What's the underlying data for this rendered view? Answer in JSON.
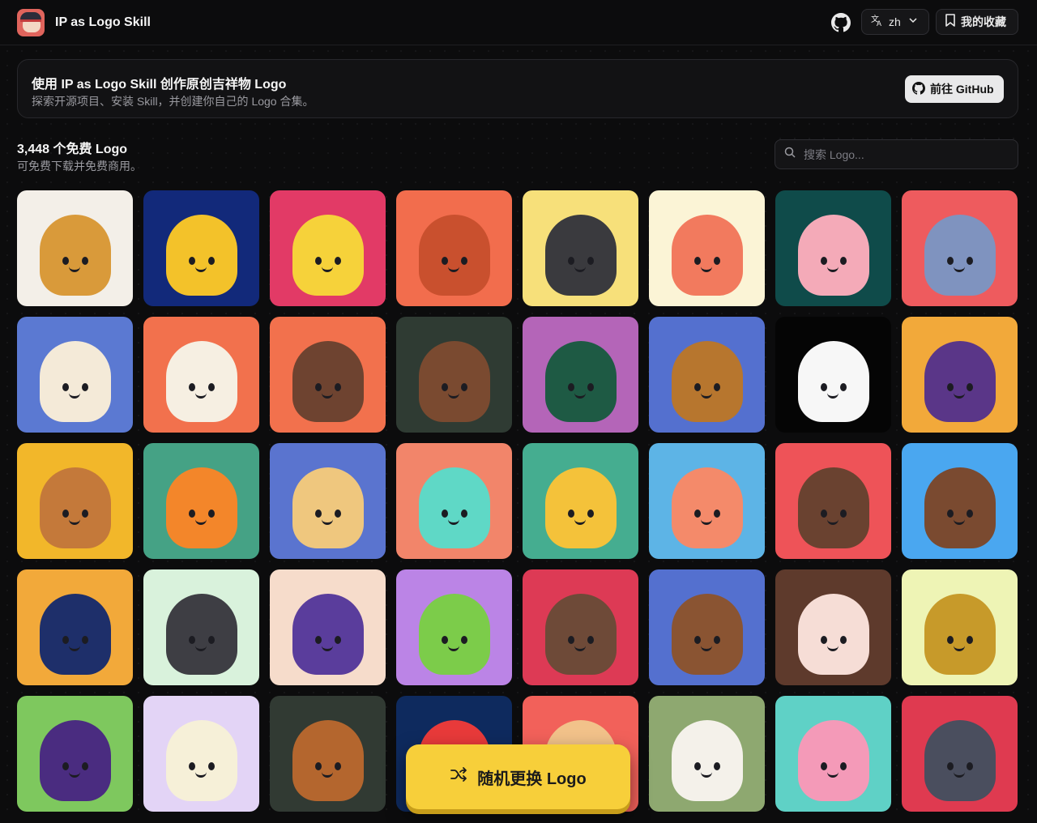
{
  "header": {
    "app_title": "IP as Logo Skill",
    "language_label": "zh",
    "favorites_label": "我的收藏"
  },
  "banner": {
    "title": "使用 IP as Logo Skill 创作原创吉祥物 Logo",
    "subtitle": "探索开源项目、安装 Skill，并创建你自己的 Logo 合集。",
    "github_button": "前往 GitHub"
  },
  "gallery": {
    "count_title": "3,448 个免费 Logo",
    "count_subtitle": "可免费下载并免费商用。",
    "search_placeholder": "搜索 Logo...",
    "tiles": [
      {
        "bg": "#f3efe8",
        "char": "#d99a3a"
      },
      {
        "bg": "#12297a",
        "char": "#f3c22a"
      },
      {
        "bg": "#e23a66",
        "char": "#f6d23a"
      },
      {
        "bg": "#f26d4d",
        "char": "#c9502e"
      },
      {
        "bg": "#f7e07a",
        "char": "#3a3a3e"
      },
      {
        "bg": "#fbf4d6",
        "char": "#f27a5e"
      },
      {
        "bg": "#0f4b4a",
        "char": "#f4aab8"
      },
      {
        "bg": "#ee5b5e",
        "char": "#7f93bf"
      },
      {
        "bg": "#5b79d2",
        "char": "#f4ead8"
      },
      {
        "bg": "#f2714d",
        "char": "#f6efe2"
      },
      {
        "bg": "#f2714d",
        "char": "#6e4330"
      },
      {
        "bg": "#2f3b33",
        "char": "#7a4a30"
      },
      {
        "bg": "#b465b8",
        "char": "#1e5a44"
      },
      {
        "bg": "#5470cf",
        "char": "#b7762e"
      },
      {
        "bg": "#050505",
        "char": "#f7f7f7"
      },
      {
        "bg": "#f2a93a",
        "char": "#5a3688"
      },
      {
        "bg": "#f2b72a",
        "char": "#c4793a"
      },
      {
        "bg": "#45a285",
        "char": "#f3862a"
      },
      {
        "bg": "#5a74cf",
        "char": "#efc77e"
      },
      {
        "bg": "#f2856a",
        "char": "#5fd8c6"
      },
      {
        "bg": "#45ad90",
        "char": "#f4c23a"
      },
      {
        "bg": "#5db4e6",
        "char": "#f48a6a"
      },
      {
        "bg": "#ee5358",
        "char": "#6a4230"
      },
      {
        "bg": "#4aa7f0",
        "char": "#7a4a30"
      },
      {
        "bg": "#f2a93a",
        "char": "#1e2f6a"
      },
      {
        "bg": "#d9f2dc",
        "char": "#3e3e44"
      },
      {
        "bg": "#f6dccb",
        "char": "#5a3d9c"
      },
      {
        "bg": "#bb84e6",
        "char": "#7ccc4a"
      },
      {
        "bg": "#dd3a55",
        "char": "#6e4a38"
      },
      {
        "bg": "#5470cf",
        "char": "#8a5432"
      },
      {
        "bg": "#5e3a2c",
        "char": "#f6ddd6"
      },
      {
        "bg": "#eef4b5",
        "char": "#c79a2a"
      },
      {
        "bg": "#7ec85e",
        "char": "#4a2c80"
      },
      {
        "bg": "#e3d4f6",
        "char": "#f6f0d8"
      },
      {
        "bg": "#313a33",
        "char": "#b4662e"
      },
      {
        "bg": "#0e2a5e",
        "char": "#e83a3a"
      },
      {
        "bg": "#f2615a",
        "char": "#f2c28a"
      },
      {
        "bg": "#8ea870",
        "char": "#f4f1ea"
      },
      {
        "bg": "#5fd1c6",
        "char": "#f49ab8"
      },
      {
        "bg": "#df3a50",
        "char": "#4a4e5e"
      }
    ]
  },
  "random_button": "随机更换 Logo"
}
